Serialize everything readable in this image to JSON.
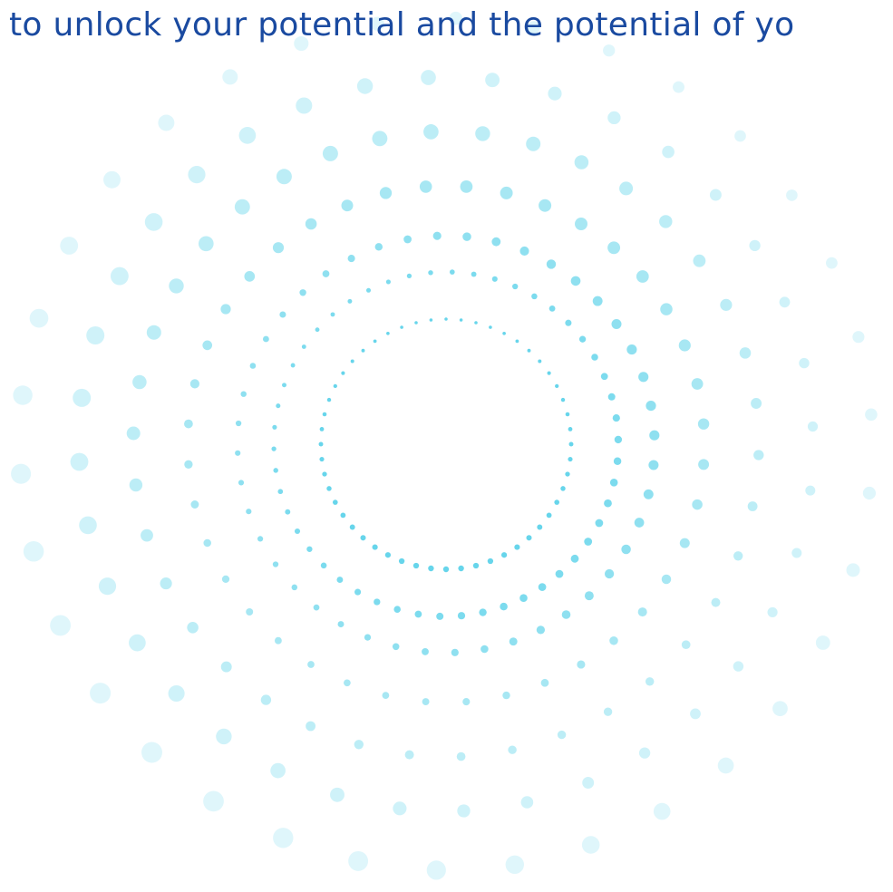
{
  "headline": {
    "text": "to unlock your potential and the potential of yo",
    "color": "#1a4aa0"
  },
  "pattern": {
    "name": "concentric-dot-rings",
    "dot_color": "#5fd3ea"
  }
}
